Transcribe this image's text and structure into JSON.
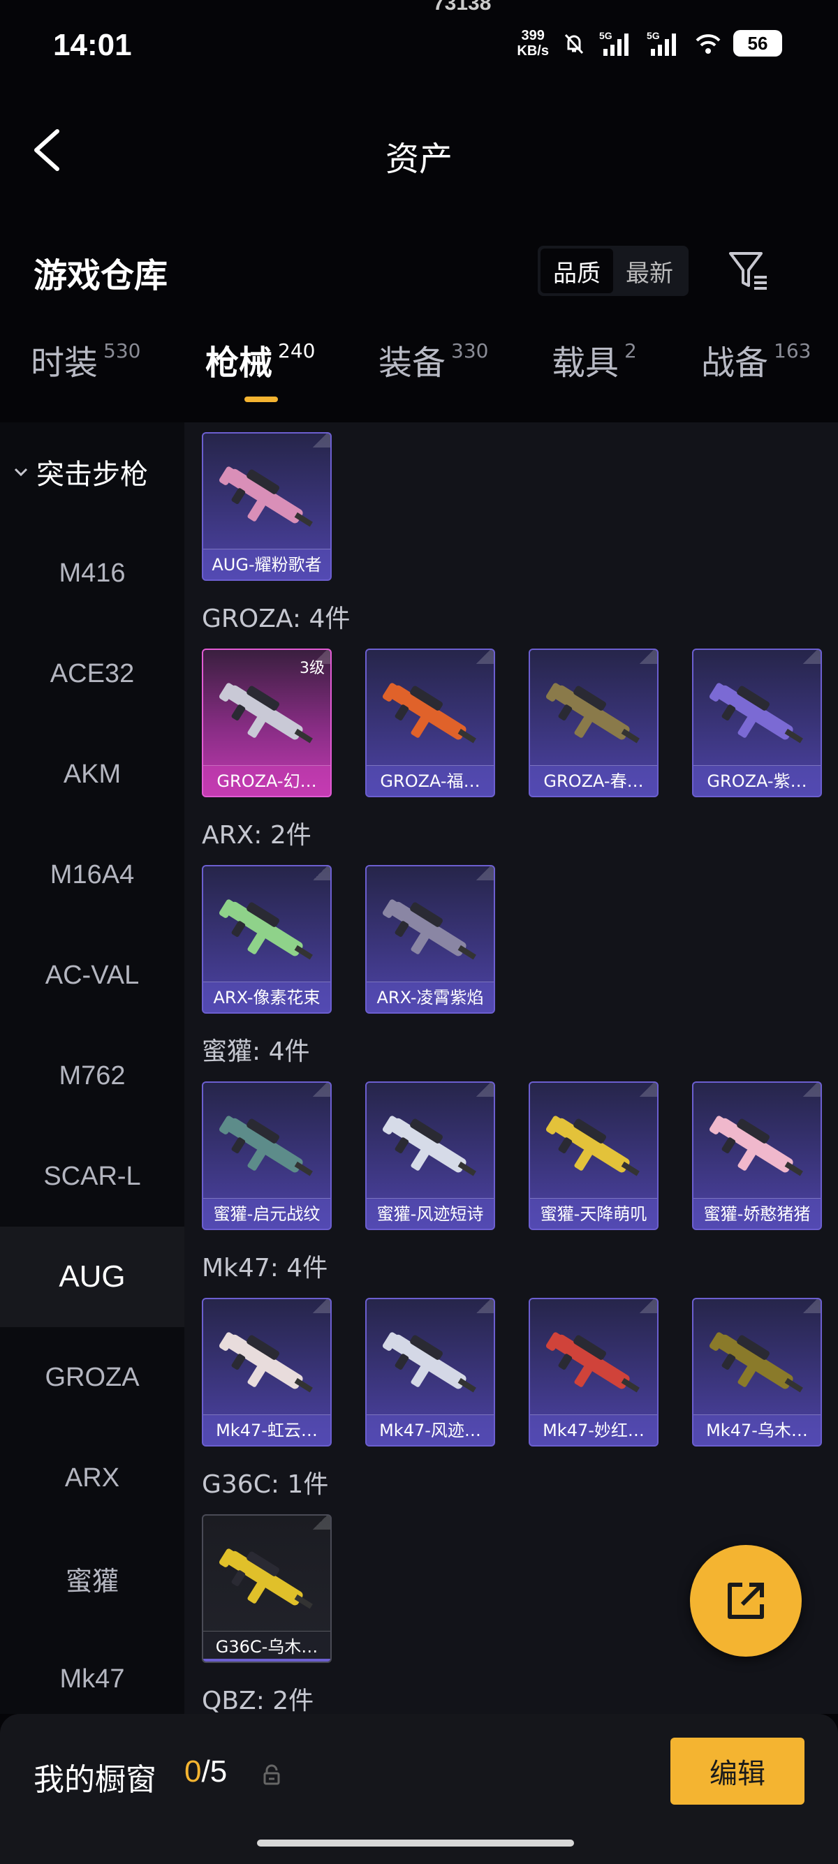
{
  "status_bar": {
    "time": "14:01",
    "network_speed_value": "399",
    "network_speed_unit": "KB/s",
    "signal1_label": "5G",
    "signal2_label": "5G",
    "battery": "56",
    "top_number": "73138"
  },
  "header": {
    "title": "资产"
  },
  "warehouse": {
    "title": "游戏仓库",
    "sort_options": [
      "品质",
      "最新"
    ],
    "active_sort": "品质"
  },
  "tabs": [
    {
      "label": "时装",
      "count": "530"
    },
    {
      "label": "枪械",
      "count": "240"
    },
    {
      "label": "装备",
      "count": "330"
    },
    {
      "label": "载具",
      "count": "2"
    },
    {
      "label": "战备",
      "count": "163"
    }
  ],
  "sidebar": {
    "category": "突击步枪",
    "items": [
      "M416",
      "ACE32",
      "AKM",
      "M16A4",
      "AC-VAL",
      "M762",
      "SCAR-L",
      "AUG",
      "GROZA",
      "ARX",
      "蜜獾",
      "Mk47"
    ],
    "active": "AUG"
  },
  "groups": [
    {
      "title": "",
      "items": [
        {
          "name": "AUG-耀粉歌者",
          "rarity": "purple",
          "color": "#d98fb8"
        }
      ]
    },
    {
      "title": "GROZA: 4件",
      "items": [
        {
          "name": "GROZA-幻…",
          "rarity": "pink",
          "level": "3级",
          "color": "#c9c9d6"
        },
        {
          "name": "GROZA-福…",
          "rarity": "purple",
          "color": "#e0622a"
        },
        {
          "name": "GROZA-春…",
          "rarity": "purple",
          "color": "#8a7a4a"
        },
        {
          "name": "GROZA-紫…",
          "rarity": "purple",
          "color": "#7b6ad4"
        }
      ]
    },
    {
      "title": "ARX: 2件",
      "items": [
        {
          "name": "ARX-像素花束",
          "rarity": "purple",
          "color": "#8fd28a"
        },
        {
          "name": "ARX-凌霄紫焰",
          "rarity": "purple",
          "color": "#8a86a4"
        }
      ]
    },
    {
      "title": "蜜獾: 4件",
      "items": [
        {
          "name": "蜜獾-启元战纹",
          "rarity": "purple",
          "color": "#5d8c8a"
        },
        {
          "name": "蜜獾-风迹短诗",
          "rarity": "purple",
          "color": "#d6dbe8"
        },
        {
          "name": "蜜獾-天降萌叽",
          "rarity": "purple",
          "color": "#e3c23a"
        },
        {
          "name": "蜜獾-娇憨猪猪",
          "rarity": "purple",
          "color": "#f0b8cc"
        }
      ]
    },
    {
      "title": "Mk47: 4件",
      "items": [
        {
          "name": "Mk47-虹云…",
          "rarity": "purple",
          "color": "#e8dcdc"
        },
        {
          "name": "Mk47-风迹…",
          "rarity": "purple",
          "color": "#d4d8e6"
        },
        {
          "name": "Mk47-妙红…",
          "rarity": "purple",
          "color": "#d0433a"
        },
        {
          "name": "Mk47-乌木…",
          "rarity": "purple",
          "color": "#8a7a2a"
        }
      ]
    },
    {
      "title": "G36C: 1件",
      "items": [
        {
          "name": "G36C-乌木…",
          "rarity": "dark",
          "color": "#e0c02a"
        }
      ]
    },
    {
      "title": "QBZ: 2件",
      "items": []
    }
  ],
  "bottom_bar": {
    "label": "我的橱窗",
    "current": "0",
    "total": "/5",
    "edit_label": "编辑"
  },
  "colors": {
    "accent": "#f4b431",
    "card_purple": "#4d43a6",
    "card_pink": "#c03bb0"
  }
}
